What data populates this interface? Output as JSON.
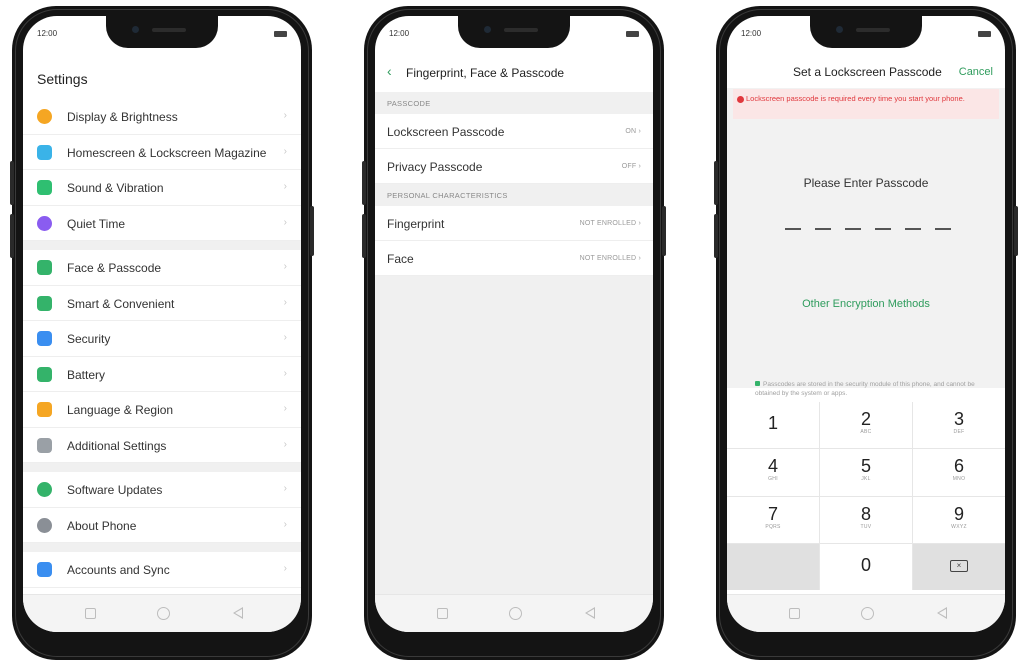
{
  "colors": {
    "accent": "#2f9c5d",
    "warning": "#e0393e",
    "background": "#f0f0f0",
    "bezel": "#141414"
  },
  "status": {
    "time": "12:00",
    "signal_icon": "signal-icon",
    "wifi_icon": "wifi-icon",
    "battery_icon": "battery-icon"
  },
  "settings": {
    "title": "Settings",
    "groups": [
      [
        {
          "label": "Display & Brightness",
          "icon": "display-brightness-icon",
          "color": "#f5a623"
        },
        {
          "label": "Homescreen & Lockscreen Magazine",
          "icon": "homescreen-icon",
          "color": "#3ab3e8"
        },
        {
          "label": "Sound & Vibration",
          "icon": "sound-icon",
          "color": "#2fbf71"
        },
        {
          "label": "Quiet Time",
          "icon": "moon-icon",
          "color": "#8a5cf0"
        }
      ],
      [
        {
          "label": "Face & Passcode",
          "icon": "face-passcode-icon",
          "color": "#34b36a"
        },
        {
          "label": "Smart & Convenient",
          "icon": "smart-icon",
          "color": "#34b36a"
        },
        {
          "label": "Security",
          "icon": "shield-icon",
          "color": "#3a8ef0"
        },
        {
          "label": "Battery",
          "icon": "battery-settings-icon",
          "color": "#34b36a"
        },
        {
          "label": "Language & Region",
          "icon": "language-icon",
          "color": "#f5a623"
        },
        {
          "label": "Additional Settings",
          "icon": "gear-icon",
          "color": "#9aa0a6"
        }
      ],
      [
        {
          "label": "Software Updates",
          "icon": "update-icon",
          "color": "#34b36a"
        },
        {
          "label": "About Phone",
          "icon": "info-icon",
          "color": "#8a8f96"
        }
      ],
      [
        {
          "label": "Accounts and Sync",
          "icon": "account-icon",
          "color": "#3a8ef0"
        }
      ]
    ]
  },
  "fingerprint": {
    "title": "Fingerprint, Face & Passcode",
    "sections": [
      {
        "header": "PASSCODE",
        "rows": [
          {
            "label": "Lockscreen Passcode",
            "value": "ON"
          },
          {
            "label": "Privacy Passcode",
            "value": "OFF"
          }
        ]
      },
      {
        "header": "PERSONAL CHARACTERISTICS",
        "rows": [
          {
            "label": "Fingerprint",
            "value": "NOT ENROLLED"
          },
          {
            "label": "Face",
            "value": "NOT ENROLLED"
          }
        ]
      }
    ]
  },
  "passcode": {
    "title": "Set a Lockscreen Passcode",
    "cancel": "Cancel",
    "warning": "Lockscreen passcode is required every time you start your phone.",
    "prompt": "Please Enter Passcode",
    "digits_required": 6,
    "other_methods": "Other Encryption Methods",
    "note": "Passcodes are stored in the security module of this phone, and cannot be obtained by the system or apps.",
    "keys": [
      {
        "num": "1",
        "letters": ""
      },
      {
        "num": "2",
        "letters": "ABC"
      },
      {
        "num": "3",
        "letters": "DEF"
      },
      {
        "num": "4",
        "letters": "GHI"
      },
      {
        "num": "5",
        "letters": "JKL"
      },
      {
        "num": "6",
        "letters": "MNO"
      },
      {
        "num": "7",
        "letters": "PQRS"
      },
      {
        "num": "8",
        "letters": "TUV"
      },
      {
        "num": "9",
        "letters": "WXYZ"
      },
      {
        "num": "",
        "letters": ""
      },
      {
        "num": "0",
        "letters": ""
      },
      {
        "num": "",
        "letters": "",
        "icon": "backspace-icon"
      }
    ]
  }
}
